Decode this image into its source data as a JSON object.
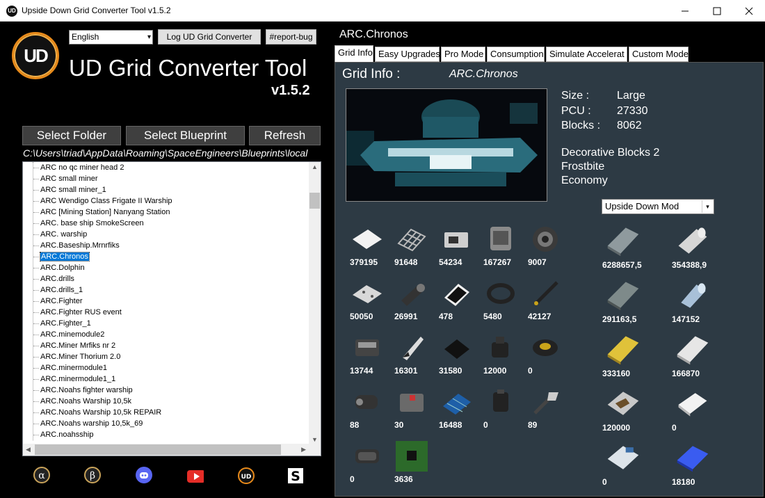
{
  "window": {
    "title": "Upside Down Grid Converter Tool v1.5.2",
    "icon_text": "UD",
    "minimize_icon": "minimize-icon",
    "maximize_icon": "maximize-icon",
    "close_icon": "close-icon"
  },
  "header": {
    "language": "English",
    "log_button": "Log UD Grid Converter",
    "report_button": "#report-bug",
    "logo_text": "UD",
    "app_title": "UD Grid Converter Tool",
    "version": "v1.5.2"
  },
  "actions": {
    "select_folder": "Select Folder",
    "select_blueprint": "Select Blueprint",
    "refresh": "Refresh"
  },
  "path": "C:\\Users\\triad\\AppData\\Roaming\\SpaceEngineers\\Blueprints\\local",
  "blueprints": {
    "items": [
      "ARC no qc miner head 2",
      "ARC small miner",
      "ARC small miner_1",
      "ARC Wendigo Class Frigate II Warship",
      "ARC [Mining Station] Nanyang Station",
      "ARC. base ship SmokeScreen",
      "ARC. warship",
      "ARC.Baseship.Mrnrfiks",
      "ARC.Chronos",
      "ARC.Dolphin",
      "ARC.drills",
      "ARC.drills_1",
      "ARC.Fighter",
      "ARC.Fighter RUS event",
      "ARC.Fighter_1",
      "ARC.minemodule2",
      "ARC.Miner Mrfiks nr 2",
      "ARC.Miner Thorium 2.0",
      "ARC.minermodule1",
      "ARC.minermodule1_1",
      "ARC.Noahs fighter warship",
      "ARC.Noahs Warship 10,5k",
      "ARC.Noahs Warship 10,5k REPAIR",
      "ARC.Noahs warship 10,5k_69",
      "ARC.noahsship"
    ],
    "selected_index": 8
  },
  "socials": [
    "alpha-icon",
    "beta-icon",
    "discord-icon",
    "youtube-icon",
    "ud-logo-icon",
    "steam-s-icon"
  ],
  "grid": {
    "title": "ARC.Chronos",
    "tabs": [
      "Grid Info",
      "Easy Upgrades",
      "Pro Mode",
      "Consumption",
      "Simulate Accelerat",
      "Custom Mode"
    ],
    "active_tab": 0,
    "info_label": "Grid Info :",
    "name": "ARC.Chronos",
    "size_label": "Size :",
    "size_value": "Large",
    "pcu_label": "PCU :",
    "pcu_value": "27330",
    "blocks_label": "Blocks :",
    "blocks_value": "8062",
    "dlc": [
      "Decorative Blocks 2",
      "Frostbite",
      "Economy"
    ],
    "mod_select": "Upside Down Mod"
  },
  "components": [
    {
      "icon": "steel-plate-icon",
      "value": "379195"
    },
    {
      "icon": "metal-grid-icon",
      "value": "91648"
    },
    {
      "icon": "computer-icon",
      "value": "54234"
    },
    {
      "icon": "construction-comp-icon",
      "value": "167267"
    },
    {
      "icon": "motor-icon",
      "value": "9007"
    },
    {
      "icon": "interior-plate-icon",
      "value": "50050"
    },
    {
      "icon": "large-tube-icon",
      "value": "26991"
    },
    {
      "icon": "display-icon",
      "value": "478"
    },
    {
      "icon": "small-tube-icon",
      "value": "5480"
    },
    {
      "icon": "girder-icon",
      "value": "42127"
    },
    {
      "icon": "power-cell-icon",
      "value": "13744"
    },
    {
      "icon": "bulletproof-glass-icon",
      "value": "16301"
    },
    {
      "icon": "detector-icon",
      "value": "31580"
    },
    {
      "icon": "thruster-comp-icon",
      "value": "12000"
    },
    {
      "icon": "gravity-comp-icon",
      "value": "0"
    },
    {
      "icon": "reactor-comp-icon",
      "value": "88"
    },
    {
      "icon": "medical-comp-icon",
      "value": "30"
    },
    {
      "icon": "solar-cell-icon",
      "value": "16488"
    },
    {
      "icon": "superconductor-icon",
      "value": "0"
    },
    {
      "icon": "radio-comp-icon",
      "value": "89"
    },
    {
      "icon": "explosives-icon",
      "value": "0"
    },
    {
      "icon": "circuit-board-icon",
      "value": "3636"
    }
  ],
  "ingots": [
    {
      "icon": "iron-ingot-icon",
      "value": "6288657,5"
    },
    {
      "icon": "silicon-wafer-icon",
      "value": "354388,9"
    },
    {
      "icon": "nickel-ingot-icon",
      "value": "291163,5"
    },
    {
      "icon": "cobalt-ingot-icon",
      "value": "147152"
    },
    {
      "icon": "gold-ingot-icon",
      "value": "333160"
    },
    {
      "icon": "silver-ingot-icon",
      "value": "166870"
    },
    {
      "icon": "gravel-icon",
      "value": "120000"
    },
    {
      "icon": "platinum-ingot-icon",
      "value": "0"
    },
    {
      "icon": "magnesium-powder-icon",
      "value": "0"
    },
    {
      "icon": "uranium-ingot-icon",
      "value": "18180"
    }
  ],
  "colors": {
    "panel_bg": "#2d3a44",
    "selection": "#0078d7",
    "logo_ring": "#e88a1a"
  }
}
